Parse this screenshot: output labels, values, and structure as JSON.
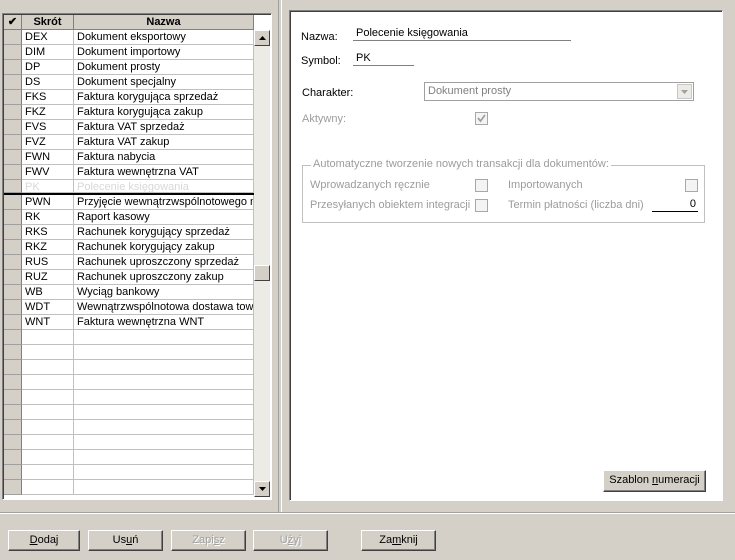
{
  "grid": {
    "columns": {
      "check": "✔",
      "code": "Skrót",
      "name": "Nazwa"
    },
    "rows": [
      {
        "code": "DEX",
        "name": "Dokument eksportowy"
      },
      {
        "code": "DIM",
        "name": "Dokument importowy"
      },
      {
        "code": "DP",
        "name": "Dokument prosty"
      },
      {
        "code": "DS",
        "name": "Dokument specjalny"
      },
      {
        "code": "FKS",
        "name": "Faktura korygująca sprzedaż"
      },
      {
        "code": "FKZ",
        "name": "Faktura korygująca zakup"
      },
      {
        "code": "FVS",
        "name": "Faktura VAT sprzedaż"
      },
      {
        "code": "FVZ",
        "name": "Faktura VAT zakup"
      },
      {
        "code": "FWN",
        "name": "Faktura nabycia"
      },
      {
        "code": "FWV",
        "name": "Faktura wewnętrzna VAT"
      },
      {
        "code": "PK",
        "name": "Polecenie księgowania",
        "faded": true
      },
      {
        "code": "PWN",
        "name": "Przyjęcie wewnątrzwspólnotowego n"
      },
      {
        "code": "RK",
        "name": "Raport kasowy"
      },
      {
        "code": "RKS",
        "name": "Rachunek korygujący sprzedaż"
      },
      {
        "code": "RKZ",
        "name": "Rachunek korygujący zakup"
      },
      {
        "code": "RUS",
        "name": "Rachunek uproszczony sprzedaż"
      },
      {
        "code": "RUZ",
        "name": "Rachunek uproszczony zakup"
      },
      {
        "code": "WB",
        "name": "Wyciąg bankowy"
      },
      {
        "code": "WDT",
        "name": "Wewnątrzwspólnotowa dostawa tow"
      },
      {
        "code": "WNT",
        "name": "Faktura wewnętrzna WNT"
      }
    ],
    "empty_rows": 11
  },
  "form": {
    "name_label": "Nazwa:",
    "name_value": "Polecenie księgowania",
    "symbol_label": "Symbol:",
    "symbol_value": "PK",
    "character_label": "Charakter:",
    "character_value": "Dokument prosty",
    "active_label": "Aktywny:",
    "active_checked": true,
    "group_title": "Automatyczne tworzenie nowych transakcji dla dokumentów:",
    "manual_label": "Wprowadzanych ręcznie",
    "imported_label": "Importowanych",
    "integration_label": "Przesyłanych obiektem integracji",
    "payment_term_label": "Termin płatności (liczba dni)",
    "payment_term_value": "0",
    "template_button_prefix": "Szablon ",
    "template_button_hotkey": "n",
    "template_button_suffix": "umeracji"
  },
  "buttons": {
    "add_hotkey": "D",
    "add_rest": "odaj",
    "delete_pre": "Us",
    "delete_hotkey": "u",
    "delete_post": "ń",
    "save_pre": "Zapi",
    "save_hotkey": "s",
    "save_post": "z",
    "use_pre": "U",
    "use_hotkey": "ż",
    "use_post": "yj",
    "close_pre": "Za",
    "close_hotkey": "m",
    "close_post": "knij"
  }
}
